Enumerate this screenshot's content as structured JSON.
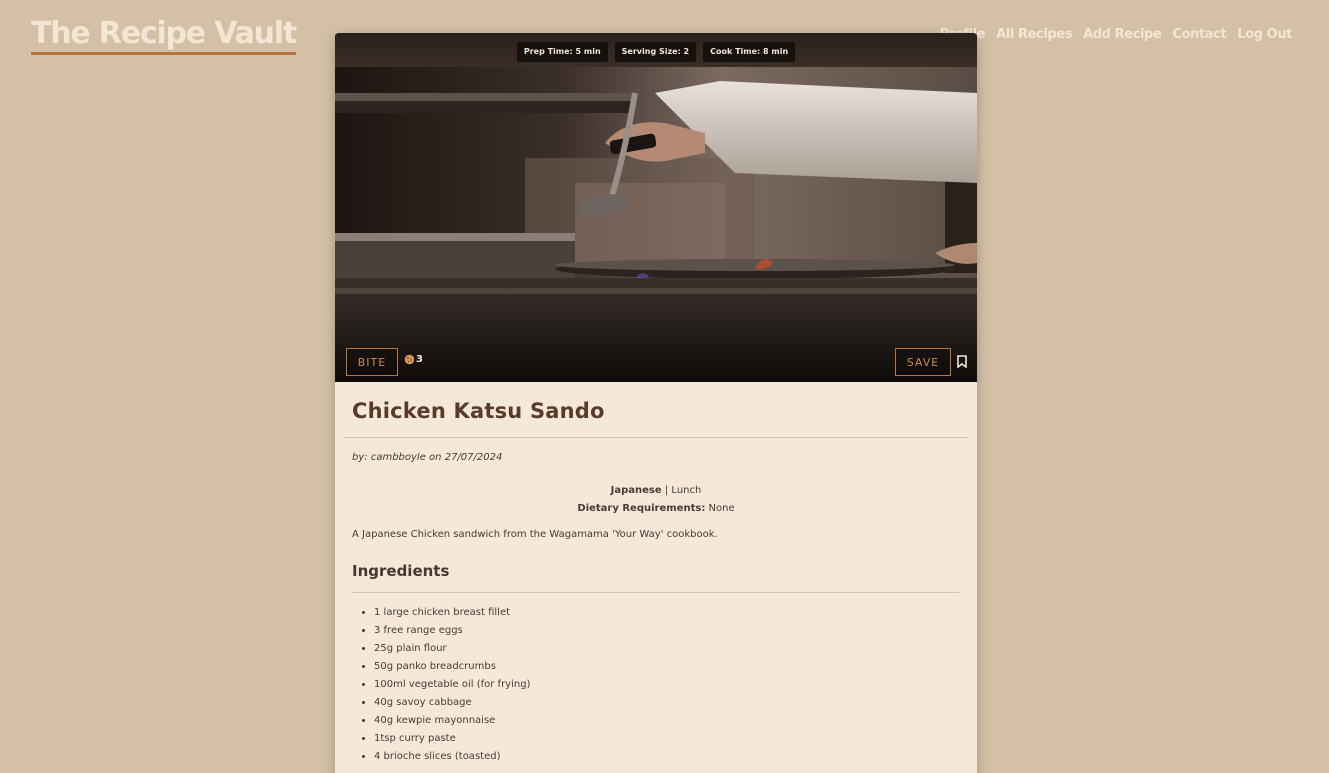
{
  "brand": "The Recipe Vault",
  "nav": [
    {
      "label": "Profile"
    },
    {
      "label": "All Recipes"
    },
    {
      "label": "Add Recipe"
    },
    {
      "label": "Contact"
    },
    {
      "label": "Log Out"
    }
  ],
  "badges": [
    {
      "text": "Prep Time: 5 min"
    },
    {
      "text": "Serving Size: 2"
    },
    {
      "text": "Cook Time: 8 min"
    }
  ],
  "actions": {
    "bite_label": "BITE",
    "bite_count": "3",
    "save_label": "SAVE"
  },
  "recipe": {
    "title": "Chicken Katsu Sando",
    "by_prefix": "by:",
    "author": "cambboyle",
    "on": "on",
    "date": "27/07/2024",
    "cuisine": "Japanese",
    "separator": "|",
    "meal": "Lunch",
    "dietary_label": "Dietary Requirements:",
    "dietary_value": "None",
    "description": "A Japanese Chicken sandwich from the Wagamama 'Your Way' cookbook."
  },
  "ingredients_heading": "Ingredients",
  "ingredients": [
    "1 large chicken breast fillet",
    "3 free range eggs",
    "25g plain flour",
    "50g panko breadcrumbs",
    "100ml vegetable oil (for frying)",
    "40g savoy cabbage",
    "40g kewpie mayonnaise",
    "1tsp curry paste",
    "4 brioche slices (toasted)"
  ],
  "colors": {
    "background": "#d3c0a6",
    "card": "#f4e8d8",
    "accent": "#b8743f",
    "title": "#5a3b2b"
  }
}
